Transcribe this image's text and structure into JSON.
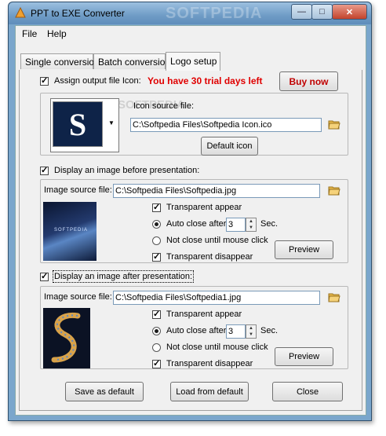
{
  "window": {
    "title": "PPT to EXE Converter",
    "watermark": "SOFTPEDIA",
    "controls": {
      "minimize": "—",
      "maximize": "□",
      "close": "✕"
    }
  },
  "menu": {
    "file": "File",
    "help": "Help"
  },
  "tabs": [
    {
      "label": "Single conversion"
    },
    {
      "label": "Batch conversion"
    },
    {
      "label": "Logo setup"
    }
  ],
  "icon_section": {
    "assign_label": "Assign output file Icon:",
    "assign_checked": true,
    "trial_notice": "You have 30 trial days left",
    "buy_button": "Buy now",
    "preview_letter": "S",
    "source_label": "Icon source file:",
    "source_value": "C:\\Softpedia Files\\Softpedia Icon.ico",
    "default_button": "Default icon",
    "watermark": "SOFTPEDIA"
  },
  "before_section": {
    "checkbox_label": "Display an image before presentation:",
    "checked": true,
    "source_label": "Image source file:",
    "source_value": "C:\\Softpedia Files\\Softpedia.jpg",
    "transparent_appear": "Transparent appear",
    "auto_close": "Auto close after",
    "auto_close_value": "3",
    "sec": "Sec.",
    "not_close": "Not close until mouse click",
    "transparent_disappear": "Transparent disappear",
    "preview_button": "Preview",
    "thumb_text": "SOFTPEDIA"
  },
  "after_section": {
    "checkbox_label": "Display an image after presentation:",
    "checked": true,
    "source_label": "Image source file:",
    "source_value": "C:\\Softpedia Files\\Softpedia1.jpg",
    "transparent_appear": "Transparent appear",
    "auto_close": "Auto close after",
    "auto_close_value": "3",
    "sec": "Sec.",
    "not_close": "Not close until mouse click",
    "transparent_disappear": "Transparent disappear",
    "preview_button": "Preview"
  },
  "footer": {
    "save_default": "Save as default",
    "load_default": "Load from default",
    "close": "Close"
  },
  "colors": {
    "title_bar": "#6f9cc6",
    "trial_text": "#e00000",
    "icon_bg": "#0e2348"
  }
}
